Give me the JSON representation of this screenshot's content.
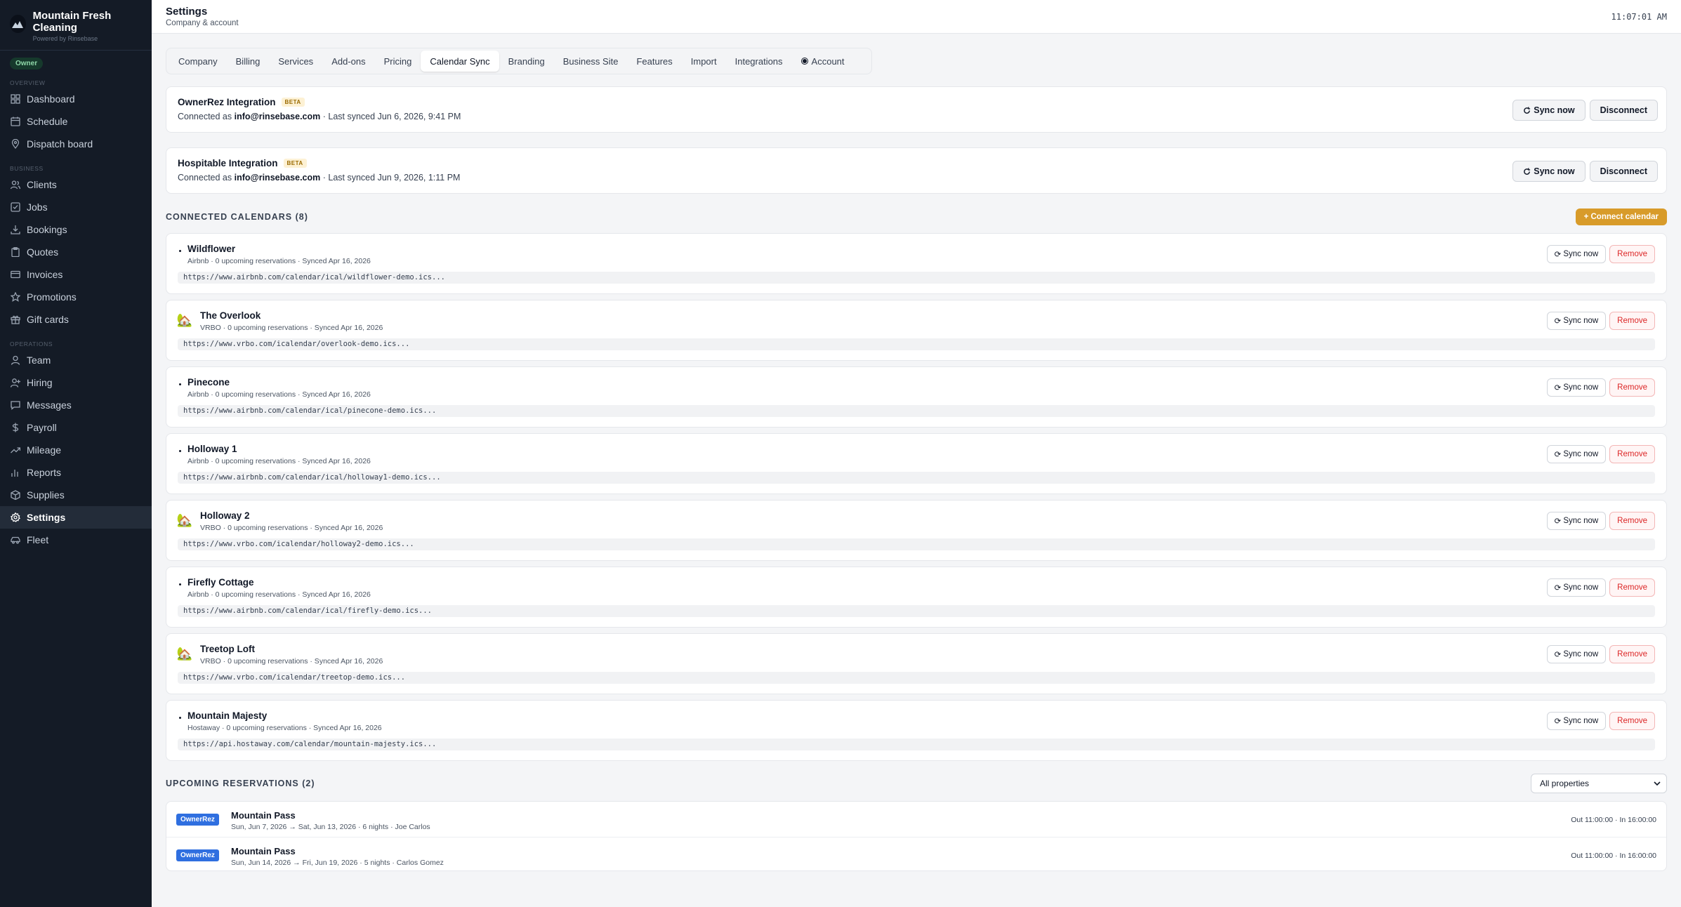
{
  "brand": {
    "name": "Mountain Fresh Cleaning",
    "powered_by": "Powered by Rinsebase",
    "role": "Owner"
  },
  "sidebar": {
    "sections": [
      {
        "label": "OVERVIEW",
        "items": [
          {
            "label": "Dashboard",
            "icon": "grid-icon"
          },
          {
            "label": "Schedule",
            "icon": "calendar-icon"
          },
          {
            "label": "Dispatch board",
            "icon": "map-pin-icon"
          }
        ]
      },
      {
        "label": "BUSINESS",
        "items": [
          {
            "label": "Clients",
            "icon": "users-icon"
          },
          {
            "label": "Jobs",
            "icon": "checkbox-icon"
          },
          {
            "label": "Bookings",
            "icon": "download-icon"
          },
          {
            "label": "Quotes",
            "icon": "clipboard-icon"
          },
          {
            "label": "Invoices",
            "icon": "card-icon"
          },
          {
            "label": "Promotions",
            "icon": "star-icon"
          },
          {
            "label": "Gift cards",
            "icon": "gift-icon"
          }
        ]
      },
      {
        "label": "OPERATIONS",
        "items": [
          {
            "label": "Team",
            "icon": "user-icon"
          },
          {
            "label": "Hiring",
            "icon": "user-plus-icon"
          },
          {
            "label": "Messages",
            "icon": "message-icon"
          },
          {
            "label": "Payroll",
            "icon": "dollar-icon"
          },
          {
            "label": "Mileage",
            "icon": "trend-icon"
          },
          {
            "label": "Reports",
            "icon": "bar-chart-icon"
          },
          {
            "label": "Supplies",
            "icon": "box-icon"
          },
          {
            "label": "Settings",
            "icon": "gear-icon",
            "active": true
          },
          {
            "label": "Fleet",
            "icon": "car-icon"
          }
        ]
      }
    ]
  },
  "header": {
    "title": "Settings",
    "subtitle": "Company & account",
    "clock": "11:07:01 AM"
  },
  "tabs": [
    "Company",
    "Billing",
    "Services",
    "Add-ons",
    "Pricing",
    "Calendar Sync",
    "Branding",
    "Business Site",
    "Features",
    "Import",
    "Integrations",
    "Account"
  ],
  "active_tab": "Calendar Sync",
  "integrations": [
    {
      "title": "OwnerRez Integration",
      "badge": "BETA",
      "connected_prefix": "Connected as",
      "email": "info@rinsebase.com",
      "synced": "· Last synced Jun 6, 2026, 9:41 PM",
      "sync_label": "Sync now",
      "disconnect_label": "Disconnect"
    },
    {
      "title": "Hospitable Integration",
      "badge": "BETA",
      "connected_prefix": "Connected as",
      "email": "info@rinsebase.com",
      "synced": "· Last synced Jun 9, 2026, 1:11 PM",
      "sync_label": "Sync now",
      "disconnect_label": "Disconnect"
    }
  ],
  "calendars_section": {
    "title": "CONNECTED CALENDARS (8)",
    "connect_label": "+ Connect calendar"
  },
  "calendars": [
    {
      "name": "Wildflower",
      "meta": "Airbnb · 0 upcoming reservations · Synced Apr 16, 2026",
      "url": "https://www.airbnb.com/calendar/ical/wildflower-demo.ics...",
      "icon": "dot"
    },
    {
      "name": "The Overlook",
      "meta": "VRBO · 0 upcoming reservations · Synced Apr 16, 2026",
      "url": "https://www.vrbo.com/icalendar/overlook-demo.ics...",
      "icon": "house"
    },
    {
      "name": "Pinecone",
      "meta": "Airbnb · 0 upcoming reservations · Synced Apr 16, 2026",
      "url": "https://www.airbnb.com/calendar/ical/pinecone-demo.ics...",
      "icon": "dot"
    },
    {
      "name": "Holloway 1",
      "meta": "Airbnb · 0 upcoming reservations · Synced Apr 16, 2026",
      "url": "https://www.airbnb.com/calendar/ical/holloway1-demo.ics...",
      "icon": "dot"
    },
    {
      "name": "Holloway 2",
      "meta": "VRBO · 0 upcoming reservations · Synced Apr 16, 2026",
      "url": "https://www.vrbo.com/icalendar/holloway2-demo.ics...",
      "icon": "house"
    },
    {
      "name": "Firefly Cottage",
      "meta": "Airbnb · 0 upcoming reservations · Synced Apr 16, 2026",
      "url": "https://www.airbnb.com/calendar/ical/firefly-demo.ics...",
      "icon": "dot"
    },
    {
      "name": "Treetop Loft",
      "meta": "VRBO · 0 upcoming reservations · Synced Apr 16, 2026",
      "url": "https://www.vrbo.com/icalendar/treetop-demo.ics...",
      "icon": "house"
    },
    {
      "name": "Mountain Majesty",
      "meta": "Hostaway · 0 upcoming reservations · Synced Apr 16, 2026",
      "url": "https://api.hostaway.com/calendar/mountain-majesty.ics...",
      "icon": "dot"
    }
  ],
  "calendar_actions": {
    "sync_label": "Sync now",
    "remove_label": "Remove"
  },
  "reservations_section": {
    "title": "UPCOMING RESERVATIONS (2)",
    "filter_value": "All properties"
  },
  "reservations": [
    {
      "source": "OwnerRez",
      "property": "Mountain Pass",
      "meta": "Sun, Jun 7, 2026 → Sat, Jun 13, 2026 · 6 nights · Joe Carlos",
      "times": "Out 11:00:00 · In 16:00:00"
    },
    {
      "source": "OwnerRez",
      "property": "Mountain Pass",
      "meta": "Sun, Jun 14, 2026 → Fri, Jun 19, 2026 · 5 nights · Carlos Gomez",
      "times": "Out 11:00:00 · In 16:00:00"
    }
  ],
  "colors": {
    "sidebar_bg": "#141b26",
    "accent": "#d89b2a",
    "remove": "#dc2626",
    "ownerrez_badge": "#2f6fe0"
  }
}
